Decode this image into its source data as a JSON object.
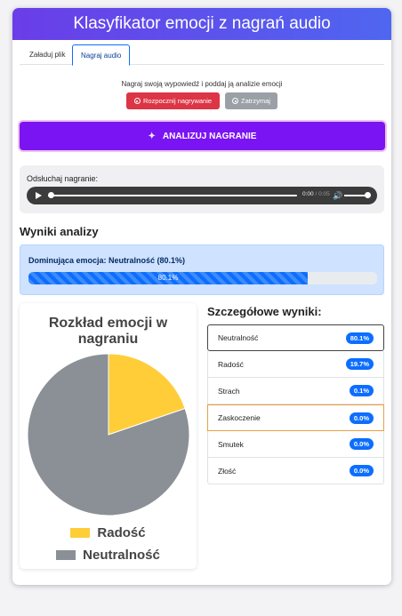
{
  "header": {
    "title": "Klasyfikator emocji z nagrań audio"
  },
  "tabs": [
    {
      "label": "Załaduj plik",
      "active": false
    },
    {
      "label": "Nagraj audio",
      "active": true
    }
  ],
  "recorder": {
    "hint": "Nagraj swoją wypowiedź i poddaj ją analizie emocji",
    "start_label": "Rozpocznij nagrywanie",
    "stop_label": "Zatrzymaj"
  },
  "analyze_button": {
    "label": "ANALIZUJ NAGRANIE",
    "icon": "sparkle-icon"
  },
  "playback": {
    "label": "Odsłuchaj nagranie:",
    "current_time": "0:00",
    "separator": " / ",
    "duration": "0:05"
  },
  "results": {
    "title": "Wyniki analizy",
    "dominant_text": "Dominująca emocja: Neutralność (80.1%)",
    "dominant_percent": 80.1,
    "dominant_label": "80.1%"
  },
  "chart_data": {
    "type": "pie",
    "title": "Rozkład emocji w nagraniu",
    "slices": [
      {
        "label": "Radość",
        "value": 19.7,
        "color": "#ffcd38"
      },
      {
        "label": "Neutralność",
        "value": 80.1,
        "color": "#8a9096"
      }
    ],
    "legend": [
      "Radość",
      "Neutralność"
    ],
    "legend_position": "bottom"
  },
  "details": {
    "title": "Szczegółowe wyniki:",
    "items": [
      {
        "label": "Neutralność",
        "value": "80.1%"
      },
      {
        "label": "Radość",
        "value": "19.7%"
      },
      {
        "label": "Strach",
        "value": "0.1%"
      },
      {
        "label": "Zaskoczenie",
        "value": "0.0%"
      },
      {
        "label": "Smutek",
        "value": "0.0%"
      },
      {
        "label": "Złość",
        "value": "0.0%"
      }
    ]
  },
  "colors": {
    "header_gradient_start": "#6a3de8",
    "header_gradient_end": "#4f66f0",
    "record_button": "#dc3545",
    "stop_button": "#9aa0a6",
    "analyze_button": "#7b14f2",
    "badge": "#0d6efd"
  }
}
